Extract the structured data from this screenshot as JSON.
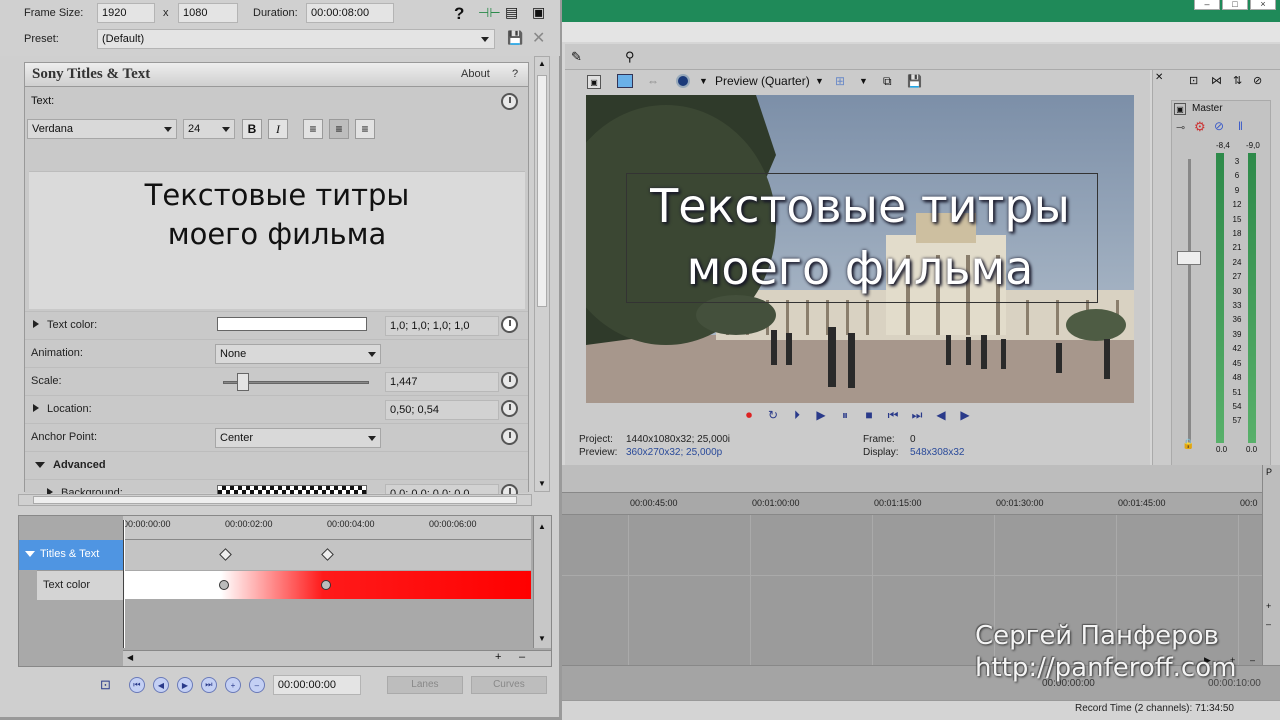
{
  "dialog": {
    "frame_size_label": "Frame Size:",
    "frame_width": "1920",
    "times": "x",
    "frame_height": "1080",
    "duration_label": "Duration:",
    "duration_value": "00:00:08:00",
    "preset_label": "Preset:",
    "preset_value": "(Default)",
    "help_icon": "question-icon"
  },
  "titles_panel": {
    "title": "Sony Titles & Text",
    "about": "About",
    "help": "?",
    "text_label": "Text:",
    "font_family": "Verdana",
    "font_size": "24",
    "bold": "B",
    "italic": "I",
    "edit_line1": "Текстовые титры",
    "edit_line2": "моего фильма",
    "text_color_label": "Text color:",
    "text_color_value": "1,0; 1,0; 1,0; 1,0",
    "animation_label": "Animation:",
    "animation_value": "None",
    "scale_label": "Scale:",
    "scale_value": "1,447",
    "location_label": "Location:",
    "location_value": "0,50; 0,54",
    "anchor_label": "Anchor Point:",
    "anchor_value": "Center",
    "advanced_label": "Advanced",
    "background_label": "Background:",
    "background_value": "0,0; 0,0; 0,0; 0,0"
  },
  "keyframes": {
    "ruler": [
      "00:00:00:00",
      "00:00:02:00",
      "00:00:04:00",
      "00:00:06:00"
    ],
    "track1": "Titles & Text",
    "track2": "Text color",
    "timecode": "00:00:00:00",
    "lanes": "Lanes",
    "curves": "Curves"
  },
  "preview": {
    "mode": "Preview (Quarter)",
    "overlay_line1": "Текстовые титры",
    "overlay_line2": "моего фильма",
    "project_label": "Project:",
    "project_value": "1440x1080x32; 25,000i",
    "preview_label": "Preview:",
    "preview_value": "360x270x32; 25,000p",
    "frame_label": "Frame:",
    "frame_value": "0",
    "display_label": "Display:",
    "display_value": "548x308x32"
  },
  "master": {
    "label": "Master",
    "peak_left": "-8,4",
    "peak_right": "-9,0",
    "scale": [
      "3",
      "6",
      "9",
      "12",
      "15",
      "18",
      "21",
      "24",
      "27",
      "30",
      "33",
      "36",
      "39",
      "42",
      "45",
      "48",
      "51",
      "54",
      "57"
    ],
    "bottom_left": "0.0",
    "bottom_right": "0.0"
  },
  "timeline": {
    "ticks": [
      "00:00:45:00",
      "00:01:00:00",
      "00:01:15:00",
      "00:01:30:00",
      "00:01:45:00",
      "00:0"
    ],
    "time_left": "00:00:00:00",
    "time_right": "00:00:10:00"
  },
  "status": {
    "record_time": "Record Time (2 channels): 71:34:50"
  },
  "watermark": {
    "line1": "Сергей Панферов",
    "line2": "http://panferoff.com"
  },
  "colors": {
    "track_blue": "#4f95e2",
    "keyframe_red": "#ff0000",
    "accent_green": "#1f8a59"
  }
}
